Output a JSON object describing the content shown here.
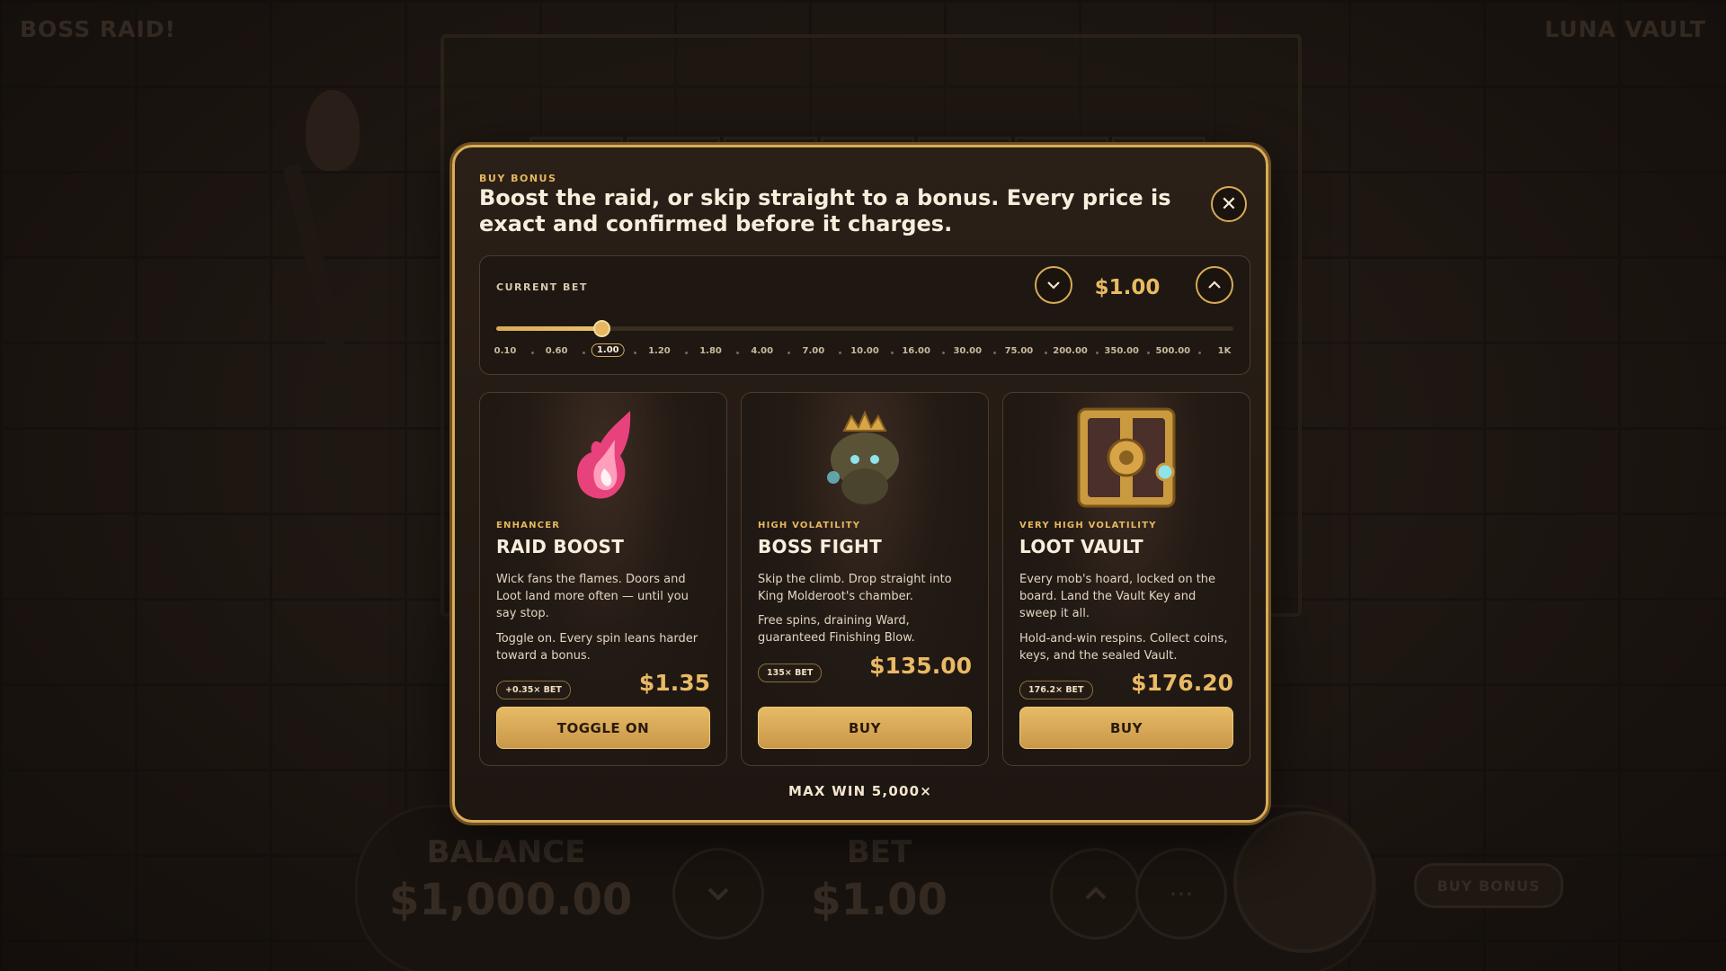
{
  "game": {
    "title_left": "BOSS RAID!",
    "title_right": "LUNA VAULT",
    "balance_label": "BALANCE",
    "balance_value": "$1,000.00",
    "bet_label": "BET",
    "bet_value": "$1.00",
    "more_label": "···",
    "buy_bonus_label": "BUY BONUS"
  },
  "modal": {
    "eyebrow": "BUY BONUS",
    "headline": "Boost the raid, or skip straight to a bonus. Every price is exact and confirmed before it charges.",
    "close_label": "✕",
    "bet": {
      "label": "CURRENT BET",
      "value": "$1.00",
      "decrease_icon": "chevron-down-icon",
      "increase_icon": "chevron-up-icon",
      "ticks": [
        "0.10",
        "0.60",
        "1.00",
        "1.20",
        "1.80",
        "4.00",
        "7.00",
        "10.00",
        "16.00",
        "30.00",
        "75.00",
        "200.00",
        "350.00",
        "500.00",
        "1K"
      ],
      "selected_index": 2,
      "slider_fraction": 0.143
    },
    "cards": [
      {
        "tag": "ENHANCER",
        "title": "RAID BOOST",
        "desc1": "Wick fans the flames. Doors and Loot land more often — until you say stop.",
        "desc2": "Toggle on. Every spin leans harder toward a bonus.",
        "badge": "+0.35× BET",
        "price": "$1.35",
        "button": "TOGGLE ON",
        "icon": "flame-icon"
      },
      {
        "tag": "HIGH VOLATILITY",
        "title": "BOSS FIGHT",
        "desc1": "Skip the climb. Drop straight into King Molderoot's chamber.",
        "desc2": "Free spins, draining Ward, guaranteed Finishing Blow.",
        "badge": "135× BET",
        "price": "$135.00",
        "button": "BUY",
        "icon": "mushroom-king-icon"
      },
      {
        "tag": "VERY HIGH VOLATILITY",
        "title": "LOOT VAULT",
        "desc1": "Every mob's hoard, locked on the board. Land the Vault Key and sweep it all.",
        "desc2": "Hold-and-win respins. Collect coins, keys, and the sealed Vault.",
        "badge": "176.2× BET",
        "price": "$176.20",
        "button": "BUY",
        "icon": "vault-chest-icon"
      }
    ],
    "max_win": "MAX WIN 5,000×"
  },
  "colors": {
    "accent_gold": "#d9ab55",
    "price_gold": "#eab964",
    "panel_bg": "#1e1712"
  }
}
